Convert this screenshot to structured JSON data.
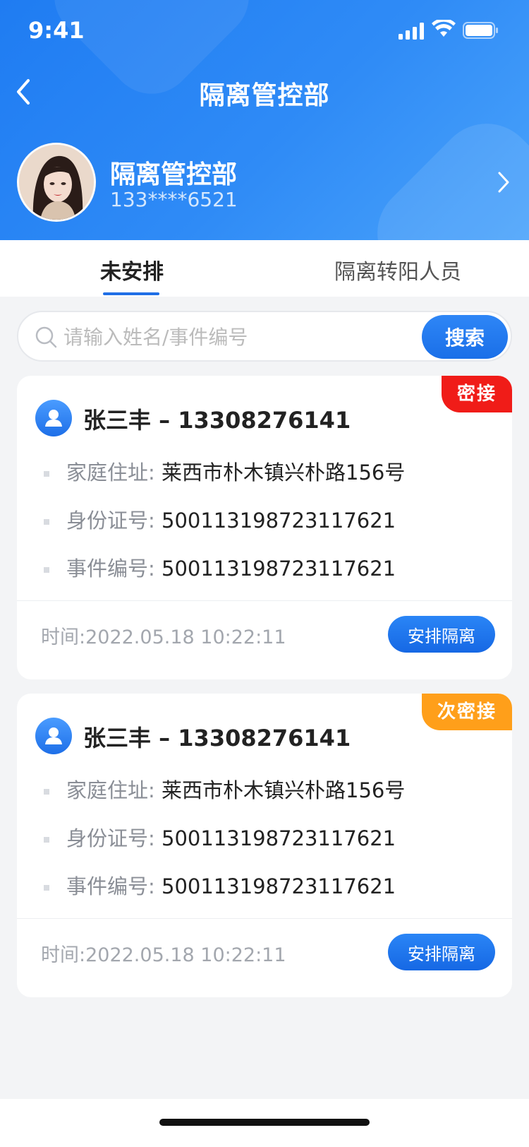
{
  "status_bar": {
    "time": "9:41"
  },
  "nav": {
    "title": "隔离管控部"
  },
  "profile": {
    "name": "隔离管控部",
    "phone": "133****6521"
  },
  "tabs": [
    {
      "label": "未安排",
      "active": true
    },
    {
      "label": "隔离转阳人员",
      "active": false
    }
  ],
  "search": {
    "placeholder": "请输入姓名/事件编号",
    "button": "搜索"
  },
  "records": [
    {
      "badge": "密接",
      "badge_color": "#f01c18",
      "title": "张三丰 – 13308276141",
      "address_label": "家庭住址:",
      "address": "莱西市朴木镇兴朴路156号",
      "id_label": "身份证号:",
      "id_number": "500113198723117621",
      "event_label": "事件编号:",
      "event_number": "500113198723117621",
      "time": "时间:2022.05.18 10:22:11",
      "action": "安排隔离"
    },
    {
      "badge": "次密接",
      "badge_color": "#ff9f1a",
      "title": "张三丰 – 13308276141",
      "address_label": "家庭住址:",
      "address": "莱西市朴木镇兴朴路156号",
      "id_label": "身份证号:",
      "id_number": "500113198723117621",
      "event_label": "事件编号:",
      "event_number": "500113198723117621",
      "time": "时间:2022.05.18 10:22:11",
      "action": "安排隔离"
    }
  ],
  "colors": {
    "primary": "#1f6fe6",
    "header_gradient_start": "#1f7cf2",
    "header_gradient_end": "#4aa3fb"
  }
}
